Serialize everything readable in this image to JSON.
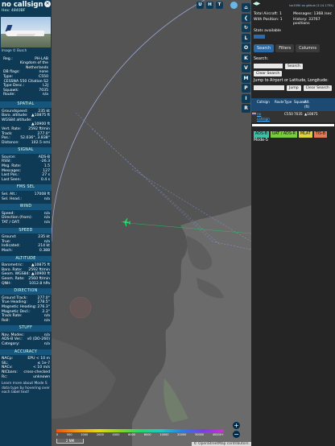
{
  "info": {
    "callsign": "no callsign",
    "hex": "Hex: 4840BF",
    "photo_credit": "Image © Busch",
    "fields_top": [
      {
        "k": "Reg.:",
        "v": "PH-LAB"
      },
      {
        "k": "",
        "v": "Kingdom of the Netherlands"
      },
      {
        "k": "DB flags:",
        "v": "none"
      },
      {
        "k": "Type:",
        "v": "C550"
      },
      {
        "k": "",
        "v": "CESSNA 550 Citation S2"
      },
      {
        "k": "Type Desc.:",
        "v": "L2J"
      },
      {
        "k": "Squawk:",
        "v": "7035"
      },
      {
        "k": "Route:",
        "v": "n/a"
      }
    ],
    "spatial_title": "SPATIAL",
    "spatial": [
      {
        "k": "Groundspeed:",
        "v": "235 kt"
      },
      {
        "k": "Baro. altitude:",
        "v": "▲10875 ft"
      },
      {
        "k": "WGS84 altitude:",
        "v": ""
      },
      {
        "k": "",
        "v": "▲10900 ft"
      },
      {
        "k": "Vert. Rate:",
        "v": "2592 ft/min"
      },
      {
        "k": "Track:",
        "v": "277.0°"
      },
      {
        "k": "Pos.:",
        "v": "52.036°, 3.838°"
      },
      {
        "k": "Distance:",
        "v": "102.5 nmi"
      }
    ],
    "signal_title": "SIGNAL",
    "signal": [
      {
        "k": "Source:",
        "v": "ADS-B"
      },
      {
        "k": "RSSI:",
        "v": "-26.3"
      },
      {
        "k": "Msg. Rate:",
        "v": "1.5"
      },
      {
        "k": "Messages:",
        "v": "127"
      },
      {
        "k": "Last Pos.:",
        "v": "27 s"
      },
      {
        "k": "Last Seen:",
        "v": "0.4 s"
      }
    ],
    "fms_title": "FMS SEL",
    "fms": [
      {
        "k": "Sel. Alt.:",
        "v": "17008 ft"
      },
      {
        "k": "Sel. Head.:",
        "v": "n/a"
      }
    ],
    "wind_title": "WIND",
    "wind": [
      {
        "k": "Speed:",
        "v": "n/a"
      },
      {
        "k": "Direction (from):",
        "v": "n/a"
      },
      {
        "k": "TAT / OAT:",
        "v": "n/a"
      }
    ],
    "speed_title": "SPEED",
    "speed": [
      {
        "k": "Ground:",
        "v": "235 kt"
      },
      {
        "k": "True:",
        "v": "n/a"
      },
      {
        "k": "Indicated:",
        "v": "214 kt"
      },
      {
        "k": "Mach:",
        "v": "0.388"
      }
    ],
    "altitude_title": "ALTITUDE",
    "altitude": [
      {
        "k": "Barometric:",
        "v": "▲10875 ft"
      },
      {
        "k": "Baro. Rate:",
        "v": "2592 ft/min"
      },
      {
        "k": "Geom. WGS84:",
        "v": "▲10900 ft"
      },
      {
        "k": "Geom. Rate:",
        "v": "2560 ft/min"
      },
      {
        "k": "QNH:",
        "v": "1012.8 hPa"
      }
    ],
    "direction_title": "DIRECTION",
    "direction": [
      {
        "k": "Ground Track:",
        "v": "277.0°"
      },
      {
        "k": "True Heading:",
        "v": "278.5°"
      },
      {
        "k": "Magnetic Heading:",
        "v": "276.3°"
      },
      {
        "k": "Magnetic Decl.:",
        "v": "2.3°"
      },
      {
        "k": "Track Rate:",
        "v": "n/a"
      },
      {
        "k": "Roll:",
        "v": "n/a"
      }
    ],
    "stuff_title": "STUFF",
    "stuff": [
      {
        "k": "Nav. Modes:",
        "v": "n/a"
      },
      {
        "k": "ADS-B Ver.:",
        "v": "v0 (DO-260)"
      },
      {
        "k": "Category:",
        "v": "n/a"
      }
    ],
    "accuracy_title": "ACCURACY",
    "accuracy": [
      {
        "k": "NACp:",
        "v": "EPU < 10 m"
      },
      {
        "k": "SIL:",
        "v": "≤ 1e-7"
      },
      {
        "k": "NACv:",
        "v": "< 10 m/s"
      },
      {
        "k": "NICbaro:",
        "v": "cross-checked"
      },
      {
        "k": "Rc:",
        "v": "unknown"
      }
    ],
    "footer": "Learn more about Mode S data type by hovering over each label text!"
  },
  "map": {
    "buttons": [
      "U",
      "H",
      "T"
    ],
    "zoom_in": "+",
    "zoom_out": "−",
    "alt_labels": [
      "0",
      "500",
      "1000",
      "2000",
      "4000",
      "6000",
      "8000",
      "10000",
      "20000",
      "30000",
      "40000+"
    ],
    "scale_label": "2 NM",
    "attribution": "© OpenStreetMap contributors.",
    "land_color": "#6b6b6b",
    "sea_color": "#545454"
  },
  "toolbar": {
    "items": [
      "⌂",
      "❮",
      "↻",
      "L",
      "O",
      "K",
      "V",
      "M",
      "P",
      "I",
      "R"
    ]
  },
  "sidebar": {
    "version": "tar1090 on github (3.14.1755)",
    "stats": [
      {
        "label": "Total Aircraft: 1"
      },
      {
        "label": "Messages: 1368 /sec"
      },
      {
        "label": "With Position: 1"
      },
      {
        "label": "History: 33767 positions"
      }
    ],
    "stats_all": "Stats available",
    "tabs": [
      "Search",
      "Filters",
      "Columns"
    ],
    "search": {
      "label": "Search:",
      "placeholder": "",
      "search_btn": "Search",
      "clear_btn": "Clear Search",
      "jump_label": "Jump to Airport or Latitude, Longitude:",
      "jump_btn": "Jump",
      "clear_btn2": "Clear Search"
    },
    "table_headers": [
      "",
      "Callsign",
      "Route",
      "Type",
      "Squawk",
      "Alt. (ft)",
      ""
    ],
    "table_rows": [
      {
        "callsign": "no callsign",
        "route": "",
        "type": "C550",
        "squawk": "7035",
        "alt": "▲10875"
      }
    ],
    "chips": [
      {
        "label": "ADS-B",
        "color": "#3fbfa5"
      },
      {
        "label": "UAT / ADS-R",
        "color": "#79cc3a"
      },
      {
        "label": "MLAT",
        "color": "#dfd33a"
      },
      {
        "label": "TIS-B",
        "color": "#e07b58"
      }
    ],
    "mode_s": "Mode-S"
  }
}
